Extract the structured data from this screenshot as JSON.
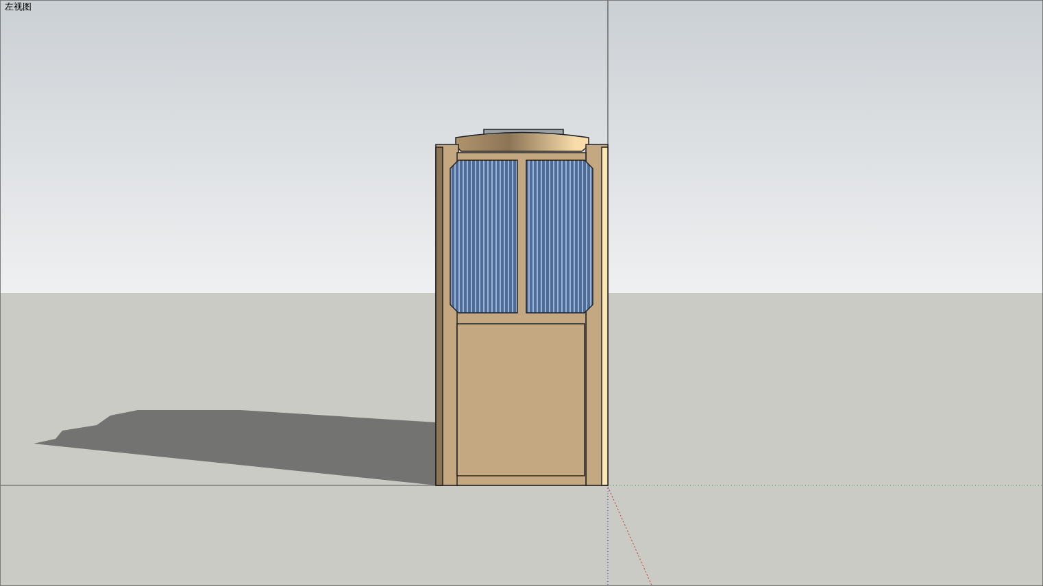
{
  "viewport": {
    "view_name": "左视图"
  }
}
